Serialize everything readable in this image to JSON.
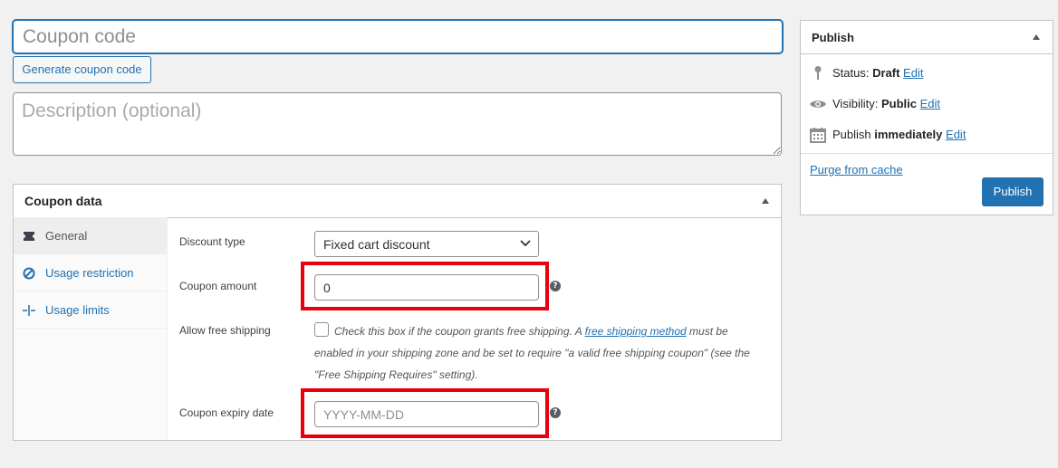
{
  "coupon_code": {
    "placeholder": "Coupon code",
    "value": ""
  },
  "generate_button": "Generate coupon code",
  "description": {
    "placeholder": "Description (optional)",
    "value": ""
  },
  "coupon_data": {
    "title": "Coupon data",
    "tabs": [
      {
        "label": "General",
        "icon": "ticket-icon",
        "active": true
      },
      {
        "label": "Usage restriction",
        "icon": "restriction-icon",
        "active": false
      },
      {
        "label": "Usage limits",
        "icon": "limits-icon",
        "active": false
      }
    ],
    "fields": {
      "discount_type": {
        "label": "Discount type",
        "value": "Fixed cart discount"
      },
      "coupon_amount": {
        "label": "Coupon amount",
        "value": "0"
      },
      "free_shipping": {
        "label": "Allow free shipping",
        "text_before": "Check this box if the coupon grants free shipping. A ",
        "link": "free shipping method",
        "text_after": " must be enabled in your shipping zone and be set to require \"a valid free shipping coupon\" (see the \"Free Shipping Requires\" setting).",
        "checked": false
      },
      "expiry_date": {
        "label": "Coupon expiry date",
        "placeholder": "YYYY-MM-DD"
      }
    },
    "help_glyph": "?"
  },
  "publish": {
    "title": "Publish",
    "status_label": "Status: ",
    "status_value": "Draft",
    "visibility_label": "Visibility: ",
    "visibility_value": "Public",
    "schedule_label": "Publish ",
    "schedule_value": "immediately",
    "edit_link": "Edit",
    "purge_link": "Purge from cache",
    "publish_button": "Publish"
  },
  "colors": {
    "accent": "#2271b1",
    "highlight_box": "#e8000b",
    "background": "#f1f1f1"
  }
}
